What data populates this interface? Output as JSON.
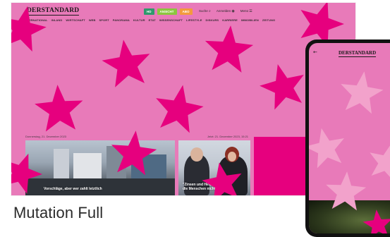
{
  "colors": {
    "pink": "#e87ab9",
    "magenta": "#e6007e",
    "light_star": "#f2a2cb",
    "pill_green": "#2f9a6d",
    "pill_lime": "#8cc63f",
    "pill_orange": "#f39a3d"
  },
  "desktop": {
    "logo": "DERSTANDARD",
    "pills": [
      {
        "label": "HD",
        "color": "#2f9a6d"
      },
      {
        "label": "ANSICHT",
        "color": "#8cc63f"
      },
      {
        "label": "ABO",
        "color": "#f39a3d"
      }
    ],
    "tools": [
      {
        "label": "Suche",
        "icon": "search-icon",
        "glyph": "⌕"
      },
      {
        "label": "Anmelden",
        "icon": "user-icon",
        "glyph": "◉"
      },
      {
        "label": "Menü",
        "icon": "menu-icon",
        "glyph": "☰"
      }
    ],
    "nav": [
      "INTERNATIONAL",
      "INLAND",
      "WIRTSCHAFT",
      "WEB",
      "SPORT",
      "PANORAMA",
      "KULTUR",
      "ETAT",
      "WISSENSCHAFT",
      "LIFESTYLE",
      "DISKURS",
      "KARRIERE",
      "IMMOBILIEN",
      "ZEITUNG"
    ],
    "date_left": "Donnerstag, 21. Dezember 2023",
    "date_right": "Jetzt: 21. Dezember 2023, 15:21",
    "caption_1": "Vorschläge, aber wer zahlt letztlich",
    "caption_2a": "\"Zinsen und Heizen",
    "caption_2b": "die Menschen nicht"
  },
  "phone": {
    "back_icon": "back-arrow-icon",
    "back_glyph": "←",
    "logo": "DERSTANDARD"
  },
  "label": "Mutation Full"
}
